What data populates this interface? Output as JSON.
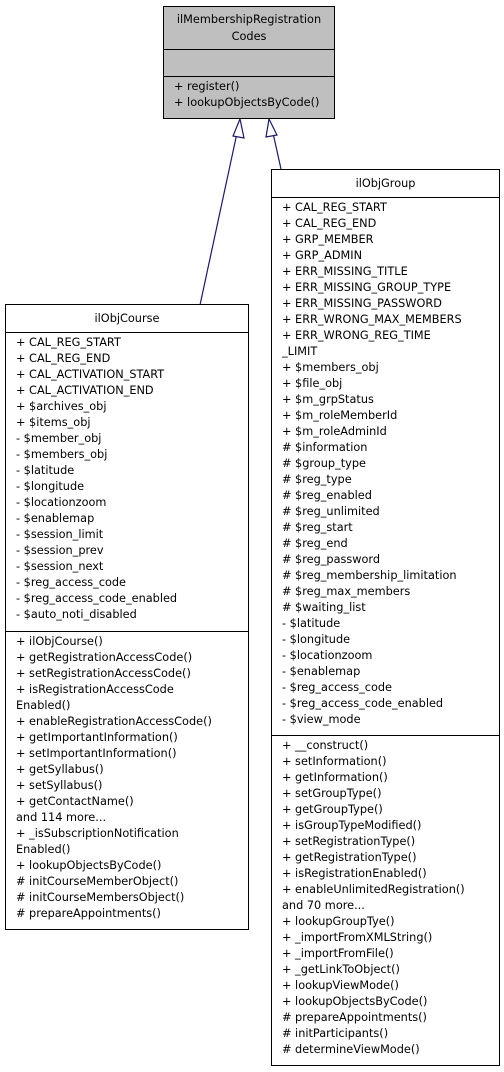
{
  "colors": {
    "base_fill": "#bfbfbf",
    "edge": "#191970",
    "box_fill": "#ffffff"
  },
  "base_class": {
    "title_lines": [
      "ilMembershipRegistration",
      "Codes"
    ],
    "attributes": [],
    "methods": [
      "+ register()",
      "+ lookupObjectsByCode()"
    ]
  },
  "course_class": {
    "title": "ilObjCourse",
    "attributes": [
      "+ CAL_REG_START",
      "+ CAL_REG_END",
      "+ CAL_ACTIVATION_START",
      "+ CAL_ACTIVATION_END",
      "+ $archives_obj",
      "+ $items_obj",
      "- $member_obj",
      "- $members_obj",
      "- $latitude",
      "- $longitude",
      "- $locationzoom",
      "- $enablemap",
      "- $session_limit",
      "- $session_prev",
      "- $session_next",
      "- $reg_access_code",
      "- $reg_access_code_enabled",
      "- $auto_noti_disabled"
    ],
    "methods": [
      "+ ilObjCourse()",
      "+ getRegistrationAccessCode()",
      "+ setRegistrationAccessCode()",
      "+ isRegistrationAccessCode",
      "Enabled()",
      "+ enableRegistrationAccessCode()",
      "+ getImportantInformation()",
      "+ setImportantInformation()",
      "+ getSyllabus()",
      "+ setSyllabus()",
      "+ getContactName()",
      "and 114 more...",
      "+ _isSubscriptionNotification",
      "Enabled()",
      "+ lookupObjectsByCode()",
      "# initCourseMemberObject()",
      "# initCourseMembersObject()",
      "# prepareAppointments()"
    ]
  },
  "group_class": {
    "title": "ilObjGroup",
    "attributes": [
      "+ CAL_REG_START",
      "+ CAL_REG_END",
      "+ GRP_MEMBER",
      "+ GRP_ADMIN",
      "+ ERR_MISSING_TITLE",
      "+ ERR_MISSING_GROUP_TYPE",
      "+ ERR_MISSING_PASSWORD",
      "+ ERR_WRONG_MAX_MEMBERS",
      "+ ERR_WRONG_REG_TIME",
      "_LIMIT",
      "+ $members_obj",
      "+ $file_obj",
      "+ $m_grpStatus",
      "+ $m_roleMemberId",
      "+ $m_roleAdminId",
      "# $information",
      "# $group_type",
      "# $reg_type",
      "# $reg_enabled",
      "# $reg_unlimited",
      "# $reg_start",
      "# $reg_end",
      "# $reg_password",
      "# $reg_membership_limitation",
      "# $reg_max_members",
      "# $waiting_list",
      "- $latitude",
      "- $longitude",
      "- $locationzoom",
      "- $enablemap",
      "- $reg_access_code",
      "- $reg_access_code_enabled",
      "- $view_mode"
    ],
    "methods": [
      "+ __construct()",
      "+ setInformation()",
      "+ getInformation()",
      "+ setGroupType()",
      "+ getGroupType()",
      "+ isGroupTypeModified()",
      "+ setRegistrationType()",
      "+ getRegistrationType()",
      "+ isRegistrationEnabled()",
      "+ enableUnlimitedRegistration()",
      "and 70 more...",
      "+ lookupGroupTye()",
      "+ _importFromXMLString()",
      "+ _importFromFile()",
      "+ _getLinkToObject()",
      "+ lookupViewMode()",
      "+ lookupObjectsByCode()",
      "# prepareAppointments()",
      "# initParticipants()",
      "# determineViewMode()"
    ]
  }
}
